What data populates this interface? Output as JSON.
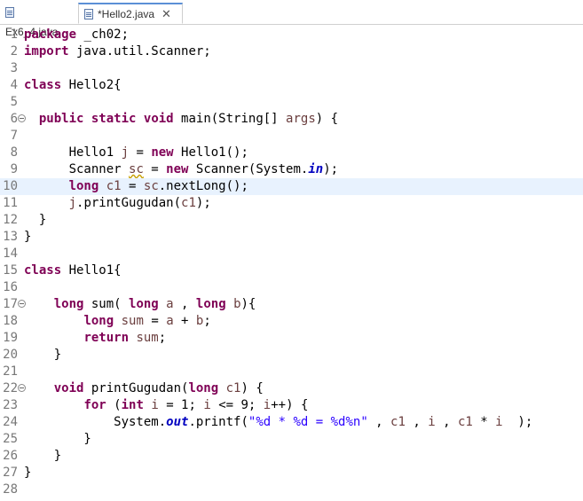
{
  "tabs": [
    {
      "label": "Ex6_4.java",
      "active": false
    },
    {
      "label": "*Hello2.java",
      "active": true,
      "close_icon": "close-icon"
    }
  ],
  "editor": {
    "current_line": 10,
    "lines": [
      {
        "n": "1",
        "tokens": [
          {
            "t": "package",
            "c": "kw"
          },
          {
            "t": " _ch02;"
          }
        ]
      },
      {
        "n": "2",
        "tokens": [
          {
            "t": "import",
            "c": "kw"
          },
          {
            "t": " java.util.Scanner;"
          }
        ]
      },
      {
        "n": "3",
        "tokens": []
      },
      {
        "n": "4",
        "tokens": [
          {
            "t": "class",
            "c": "kw"
          },
          {
            "t": " Hello2{"
          }
        ]
      },
      {
        "n": "5",
        "tokens": []
      },
      {
        "n": "6",
        "fold": true,
        "tokens": [
          {
            "t": "  "
          },
          {
            "t": "public",
            "c": "kw"
          },
          {
            "t": " "
          },
          {
            "t": "static",
            "c": "kw"
          },
          {
            "t": " "
          },
          {
            "t": "void",
            "c": "kw"
          },
          {
            "t": " main(String[] "
          },
          {
            "t": "args",
            "c": "var"
          },
          {
            "t": ") {"
          }
        ]
      },
      {
        "n": "7",
        "tokens": []
      },
      {
        "n": "8",
        "tokens": [
          {
            "t": "      Hello1 "
          },
          {
            "t": "j",
            "c": "var"
          },
          {
            "t": " = "
          },
          {
            "t": "new",
            "c": "kw"
          },
          {
            "t": " Hello1();"
          }
        ]
      },
      {
        "n": "9",
        "tokens": [
          {
            "t": "      Scanner "
          },
          {
            "t": "sc",
            "c": "var warn"
          },
          {
            "t": " = "
          },
          {
            "t": "new",
            "c": "kw"
          },
          {
            "t": " Scanner(System."
          },
          {
            "t": "in",
            "c": "fld"
          },
          {
            "t": ");"
          }
        ]
      },
      {
        "n": "10",
        "tokens": [
          {
            "t": "      "
          },
          {
            "t": "long",
            "c": "kw"
          },
          {
            "t": " "
          },
          {
            "t": "c1",
            "c": "var"
          },
          {
            "t": " = "
          },
          {
            "t": "sc",
            "c": "var"
          },
          {
            "t": ".nextLong();"
          }
        ]
      },
      {
        "n": "11",
        "tokens": [
          {
            "t": "      "
          },
          {
            "t": "j",
            "c": "var"
          },
          {
            "t": ".printGugudan("
          },
          {
            "t": "c1",
            "c": "var"
          },
          {
            "t": ");"
          }
        ]
      },
      {
        "n": "12",
        "tokens": [
          {
            "t": "  }"
          }
        ]
      },
      {
        "n": "13",
        "tokens": [
          {
            "t": "}"
          }
        ]
      },
      {
        "n": "14",
        "tokens": []
      },
      {
        "n": "15",
        "tokens": [
          {
            "t": "class",
            "c": "kw"
          },
          {
            "t": " Hello1{"
          }
        ]
      },
      {
        "n": "16",
        "tokens": []
      },
      {
        "n": "17",
        "fold": true,
        "tokens": [
          {
            "t": "    "
          },
          {
            "t": "long",
            "c": "kw"
          },
          {
            "t": " sum( "
          },
          {
            "t": "long",
            "c": "kw"
          },
          {
            "t": " "
          },
          {
            "t": "a",
            "c": "var"
          },
          {
            "t": " , "
          },
          {
            "t": "long",
            "c": "kw"
          },
          {
            "t": " "
          },
          {
            "t": "b",
            "c": "var"
          },
          {
            "t": "){"
          }
        ]
      },
      {
        "n": "18",
        "tokens": [
          {
            "t": "        "
          },
          {
            "t": "long",
            "c": "kw"
          },
          {
            "t": " "
          },
          {
            "t": "sum",
            "c": "var"
          },
          {
            "t": " = "
          },
          {
            "t": "a",
            "c": "var"
          },
          {
            "t": " + "
          },
          {
            "t": "b",
            "c": "var"
          },
          {
            "t": ";"
          }
        ]
      },
      {
        "n": "19",
        "tokens": [
          {
            "t": "        "
          },
          {
            "t": "return",
            "c": "kw"
          },
          {
            "t": " "
          },
          {
            "t": "sum",
            "c": "var"
          },
          {
            "t": ";"
          }
        ]
      },
      {
        "n": "20",
        "tokens": [
          {
            "t": "    }"
          }
        ]
      },
      {
        "n": "21",
        "tokens": []
      },
      {
        "n": "22",
        "fold": true,
        "tokens": [
          {
            "t": "    "
          },
          {
            "t": "void",
            "c": "kw"
          },
          {
            "t": " printGugudan("
          },
          {
            "t": "long",
            "c": "kw"
          },
          {
            "t": " "
          },
          {
            "t": "c1",
            "c": "var"
          },
          {
            "t": ") {"
          }
        ]
      },
      {
        "n": "23",
        "tokens": [
          {
            "t": "        "
          },
          {
            "t": "for",
            "c": "kw"
          },
          {
            "t": " ("
          },
          {
            "t": "int",
            "c": "kw"
          },
          {
            "t": " "
          },
          {
            "t": "i",
            "c": "var"
          },
          {
            "t": " = 1; "
          },
          {
            "t": "i",
            "c": "var"
          },
          {
            "t": " <= 9; "
          },
          {
            "t": "i",
            "c": "var"
          },
          {
            "t": "++) {"
          }
        ]
      },
      {
        "n": "24",
        "tokens": [
          {
            "t": "            System."
          },
          {
            "t": "out",
            "c": "fld"
          },
          {
            "t": ".printf("
          },
          {
            "t": "\"%d * %d = %d%n\"",
            "c": "str"
          },
          {
            "t": " , "
          },
          {
            "t": "c1",
            "c": "var"
          },
          {
            "t": " , "
          },
          {
            "t": "i",
            "c": "var"
          },
          {
            "t": " , "
          },
          {
            "t": "c1",
            "c": "var"
          },
          {
            "t": " * "
          },
          {
            "t": "i",
            "c": "var"
          },
          {
            "t": "  );"
          }
        ]
      },
      {
        "n": "25",
        "tokens": [
          {
            "t": "        }"
          }
        ]
      },
      {
        "n": "26",
        "tokens": [
          {
            "t": "    }"
          }
        ]
      },
      {
        "n": "27",
        "tokens": [
          {
            "t": "}"
          }
        ]
      },
      {
        "n": "28",
        "tokens": []
      }
    ]
  }
}
